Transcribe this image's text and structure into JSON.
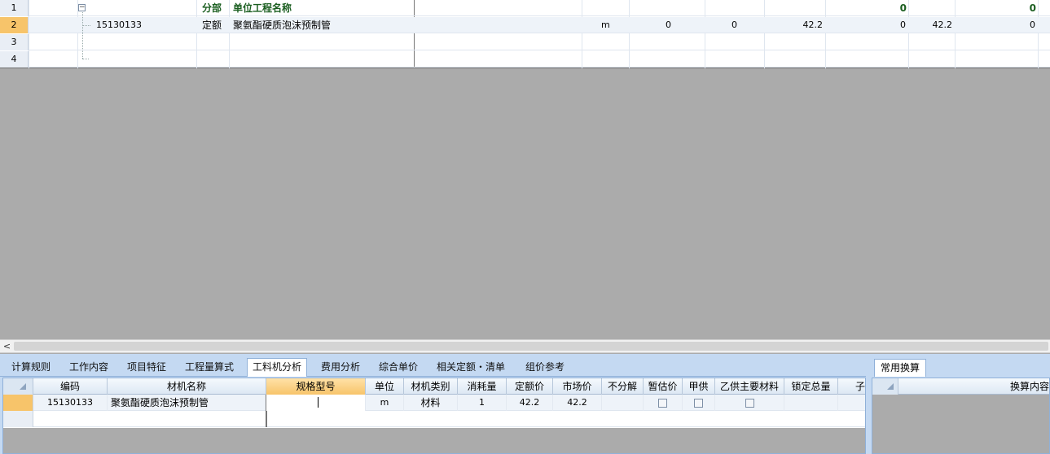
{
  "top_grid": {
    "rows": [
      {
        "num": "1",
        "code": "",
        "type": "分部",
        "name": "单位工程名称",
        "unit": "",
        "qty": "",
        "c1": "",
        "c2": "",
        "c3": "",
        "total1": "0",
        "c4": "",
        "total2": "0"
      },
      {
        "num": "2",
        "code": "15130133",
        "type": "定额",
        "name": "聚氨酯硬质泡沫预制管",
        "unit": "m",
        "qty": "0",
        "c1": "0",
        "c2": "42.2",
        "c3": "",
        "total1": "0",
        "c4": "42.2",
        "total2": "0"
      },
      {
        "num": "3"
      },
      {
        "num": "4"
      }
    ]
  },
  "tabs": [
    "计算规则",
    "工作内容",
    "项目特征",
    "工程量算式",
    "工料机分析",
    "费用分析",
    "综合单价",
    "相关定额・清单",
    "组价参考"
  ],
  "active_tab": "工料机分析",
  "material_grid": {
    "headers": [
      "编码",
      "材机名称",
      "规格型号",
      "单位",
      "材机类别",
      "消耗量",
      "定额价",
      "市场价",
      "不分解",
      "暂估价",
      "甲供",
      "乙供主要材料",
      "锁定总量",
      "子"
    ],
    "row": {
      "code": "15130133",
      "name": "聚氨酯硬质泡沫预制管",
      "spec": "",
      "unit": "m",
      "category": "材料",
      "consumption": "1",
      "quota_price": "42.2",
      "market_price": "42.2"
    }
  },
  "right_panel": {
    "tab": "常用换算",
    "header": "换算内容"
  }
}
